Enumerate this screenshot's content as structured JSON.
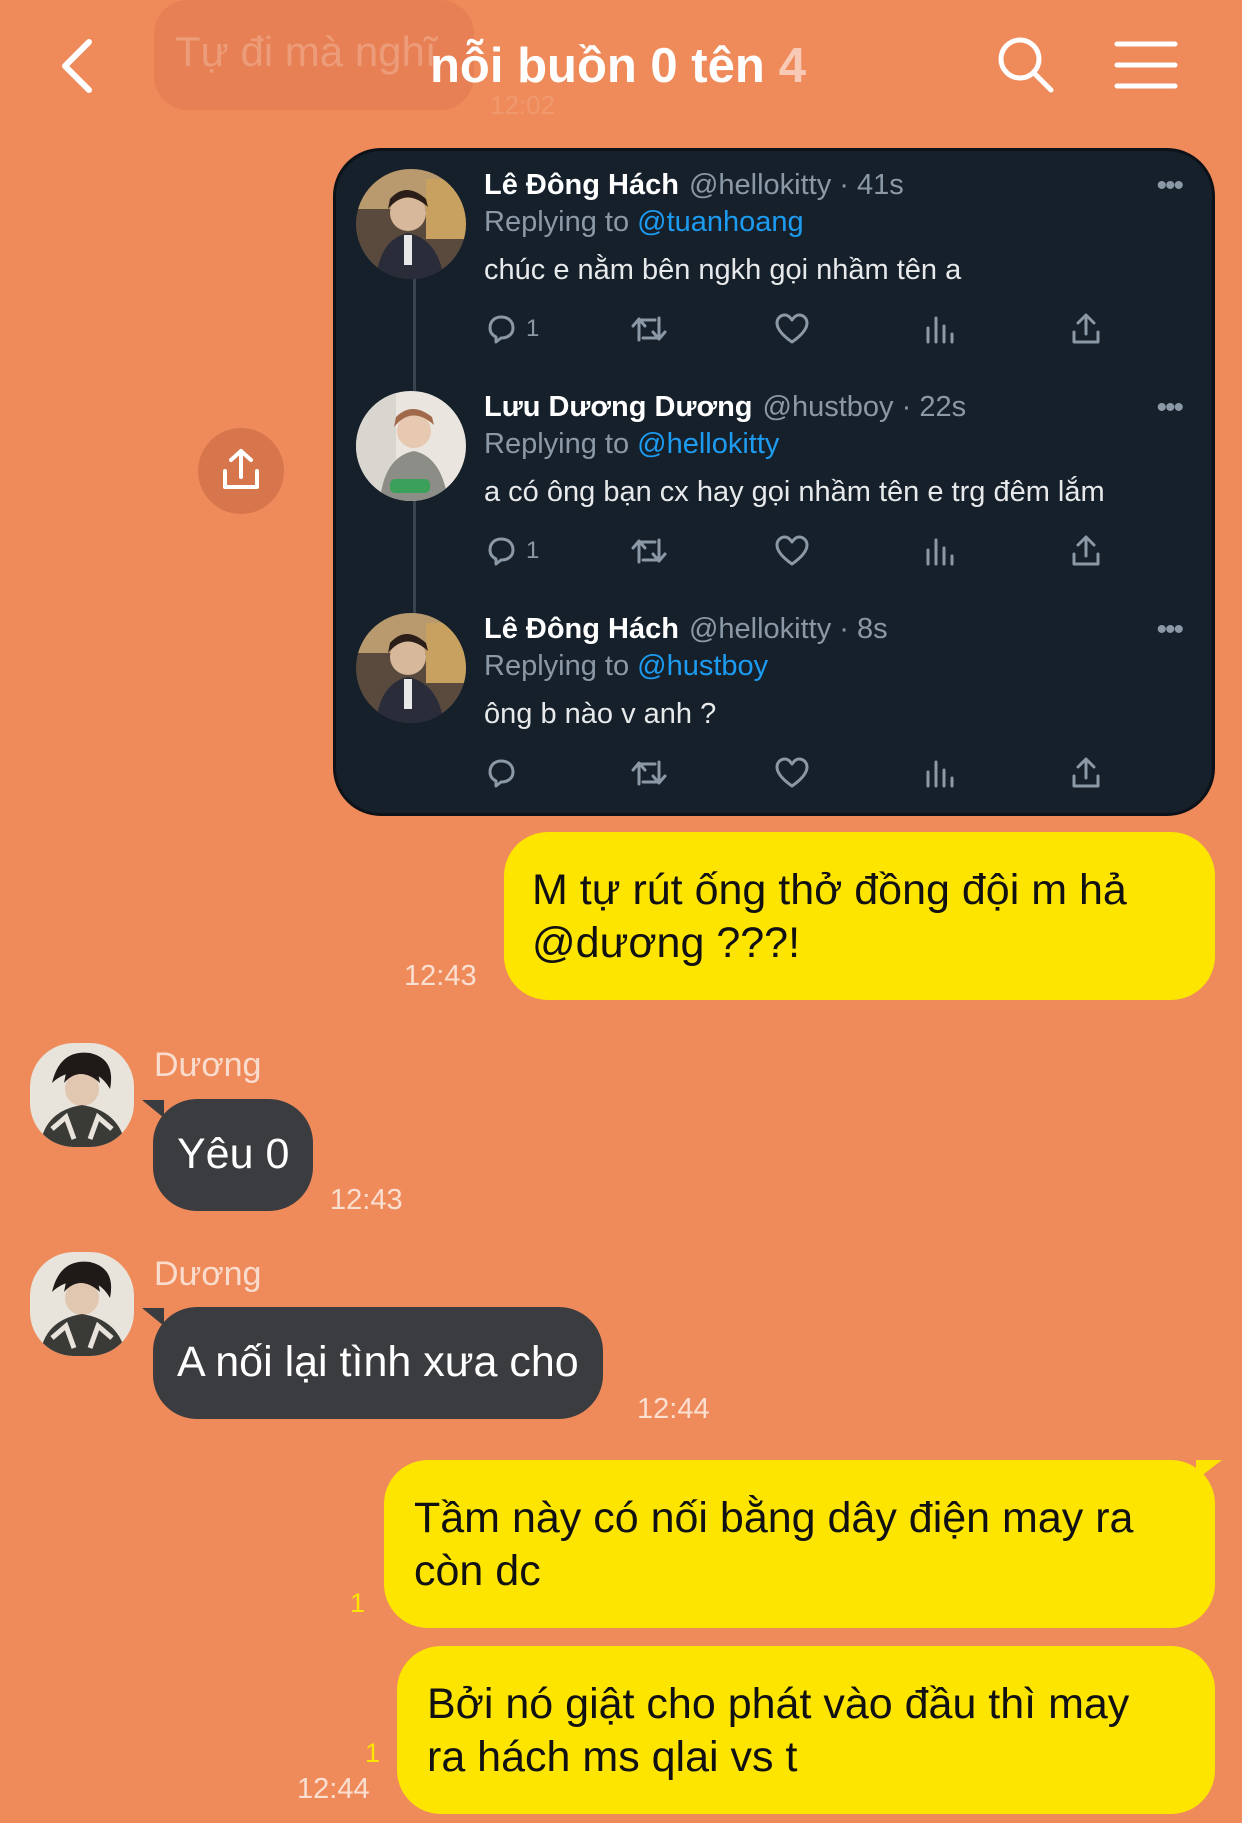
{
  "header": {
    "ghost_banner": "Tự đi mà nghĩ",
    "ghost_sub": "12:02",
    "title": "nỗi buồn 0 tên",
    "member_count": "4",
    "back_icon": "chevron-left-icon",
    "search_icon": "search-icon",
    "menu_icon": "hamburger-menu-icon"
  },
  "colors": {
    "background": "#EF8B5B",
    "my_bubble": "#FEE500",
    "their_bubble": "#3B3C40",
    "tweet_card": "#15202B",
    "mention": "#1D9BF0"
  },
  "tweets": [
    {
      "name": "Lê Đông Hách",
      "handle": "@hellokitty · 41s",
      "replying_prefix": "Replying to",
      "replying_to": "@tuanhoang",
      "text": "chúc e nằm bên ngkh gọi nhầm tên a",
      "reply_count": "1"
    },
    {
      "name": "Lưu Dương Dương",
      "handle": "@hustboy · 22s",
      "replying_prefix": "Replying to",
      "replying_to": "@hellokitty",
      "text": "a có ông bạn cx hay gọi nhầm tên e trg đêm lắm",
      "reply_count": "1"
    },
    {
      "name": "Lê Đông Hách",
      "handle": "@hellokitty · 8s",
      "replying_prefix": "Replying to",
      "replying_to": "@hustboy",
      "text": "ông b nào v anh ?",
      "reply_count": ""
    }
  ],
  "messages": [
    {
      "text_line1": "M tự rút ống thở đồng đội m hả",
      "text_line2": "@dương ???!",
      "time": "12:43"
    },
    {
      "sender": "Dương",
      "text": "Yêu 0",
      "time": "12:43"
    },
    {
      "sender": "Dương",
      "text": "A nối lại tình xưa cho",
      "time": "12:44"
    },
    {
      "text_line1": "Tầm này có nối bằng dây điện may ra",
      "text_line2": "còn dc",
      "unread": "1"
    },
    {
      "text_line1": "Bởi nó giật cho phát vào đầu thì may",
      "text_line2": "ra hách ms qlai vs t",
      "unread": "1",
      "time": "12:44"
    }
  ]
}
